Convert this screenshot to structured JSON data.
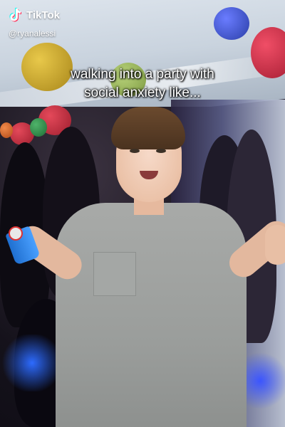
{
  "watermark": {
    "brand": "TikTok",
    "handle": "@ryanalessi",
    "icon": "tiktok-note-icon"
  },
  "caption": {
    "line1": "walking into a party with",
    "line2": "social anxiety like..."
  },
  "colors": {
    "caption_text": "#ffffff",
    "shirt": "#9a9d9b",
    "balloon_red": "#c8283a",
    "balloon_yellow": "#c9a21a",
    "accent_blue": "#2d6bff"
  }
}
